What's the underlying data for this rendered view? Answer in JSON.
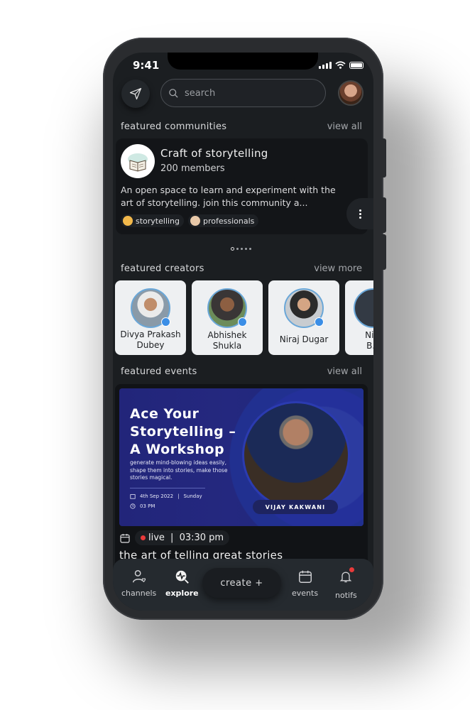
{
  "status": {
    "time": "9:41"
  },
  "header": {
    "search_placeholder": "search",
    "send_icon": "send-icon",
    "profile_icon": "avatar"
  },
  "communities": {
    "title": "featured communities",
    "link": "view all",
    "card": {
      "name": "Craft of storytelling",
      "members": "200 members",
      "description": "An open space to learn and experiment with the art of storytelling. join this community a...",
      "tags": [
        {
          "label": "storytelling",
          "color": "#f2b84b"
        },
        {
          "label": "professionals",
          "color": "#e8c8a8"
        }
      ]
    },
    "pager": {
      "total": 5,
      "active": 1
    }
  },
  "creators": {
    "title": "featured creators",
    "link": "view more",
    "items": [
      {
        "name": "Divya Prakash Dubey"
      },
      {
        "name": "Abhishek Shukla"
      },
      {
        "name": "Niraj Dugar"
      },
      {
        "name": "Ni... B..."
      }
    ]
  },
  "events": {
    "title": "featured events",
    "link": "view all",
    "card": {
      "banner_title": "Ace Your Storytelling – A Workshop",
      "banner_subtitle": "generate mind-blowing ideas easily, shape them into stories, make those stories magical.",
      "banner_date": "4th Sep 2022",
      "banner_day": "Sunday",
      "banner_time": "03 PM",
      "speaker": "VIJAY KAKWANI",
      "live_label": "live",
      "time": "03:30 pm",
      "title": "the art of telling great stories"
    }
  },
  "nav": {
    "channels": "channels",
    "explore": "explore",
    "create": "create +",
    "events": "events",
    "notifs": "notifs"
  },
  "colors": {
    "background": "#1b1e21",
    "card": "#131518",
    "accent_blue": "#3b8ee6",
    "live_red": "#e83a3a"
  }
}
